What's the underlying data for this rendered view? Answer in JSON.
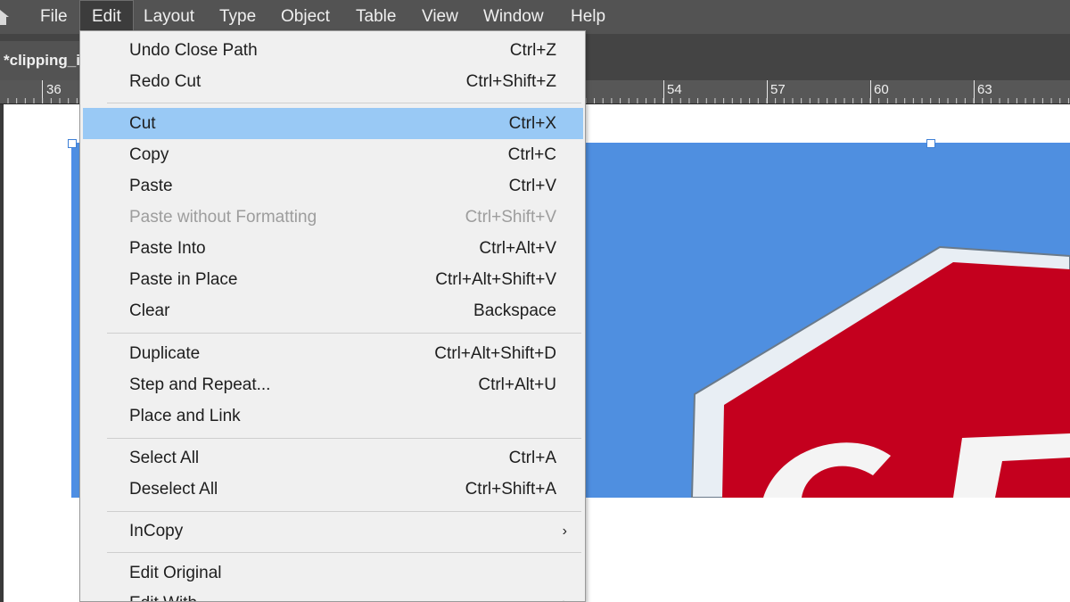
{
  "menubar": {
    "items": [
      {
        "label": "File"
      },
      {
        "label": "Edit"
      },
      {
        "label": "Layout"
      },
      {
        "label": "Type"
      },
      {
        "label": "Object"
      },
      {
        "label": "Table"
      },
      {
        "label": "View"
      },
      {
        "label": "Window"
      },
      {
        "label": "Help"
      }
    ],
    "active": "Edit"
  },
  "document_tab": {
    "label": "*clipping_i"
  },
  "ruler": {
    "labels": [
      "36",
      "54",
      "57",
      "60",
      "63"
    ]
  },
  "edit_menu": {
    "items": [
      {
        "label": "Undo Close Path",
        "shortcut": "Ctrl+Z"
      },
      {
        "label": "Redo Cut",
        "shortcut": "Ctrl+Shift+Z"
      },
      {
        "label": "Cut",
        "shortcut": "Ctrl+X",
        "highlighted": true
      },
      {
        "label": "Copy",
        "shortcut": "Ctrl+C"
      },
      {
        "label": "Paste",
        "shortcut": "Ctrl+V"
      },
      {
        "label": "Paste without Formatting",
        "shortcut": "Ctrl+Shift+V",
        "disabled": true
      },
      {
        "label": "Paste Into",
        "shortcut": "Ctrl+Alt+V"
      },
      {
        "label": "Paste in Place",
        "shortcut": "Ctrl+Alt+Shift+V"
      },
      {
        "label": "Clear",
        "shortcut": "Backspace"
      },
      {
        "label": "Duplicate",
        "shortcut": "Ctrl+Alt+Shift+D"
      },
      {
        "label": "Step and Repeat...",
        "shortcut": "Ctrl+Alt+U"
      },
      {
        "label": "Place and Link",
        "shortcut": ""
      },
      {
        "label": "Select All",
        "shortcut": "Ctrl+A"
      },
      {
        "label": "Deselect All",
        "shortcut": "Ctrl+Shift+A"
      },
      {
        "label": "InCopy",
        "shortcut": "",
        "submenu": true
      },
      {
        "label": "Edit Original",
        "shortcut": ""
      },
      {
        "label": "Edit With",
        "shortcut": "",
        "submenu": true
      }
    ]
  },
  "colors": {
    "menubar_bg": "#535353",
    "menu_bg": "#f0f0f0",
    "highlight": "#99c9f5",
    "disabled_text": "#9d9d9d",
    "sky": "#4f8fe0",
    "stop_red": "#c4001e",
    "frame_selection": "#4d8ee6"
  }
}
